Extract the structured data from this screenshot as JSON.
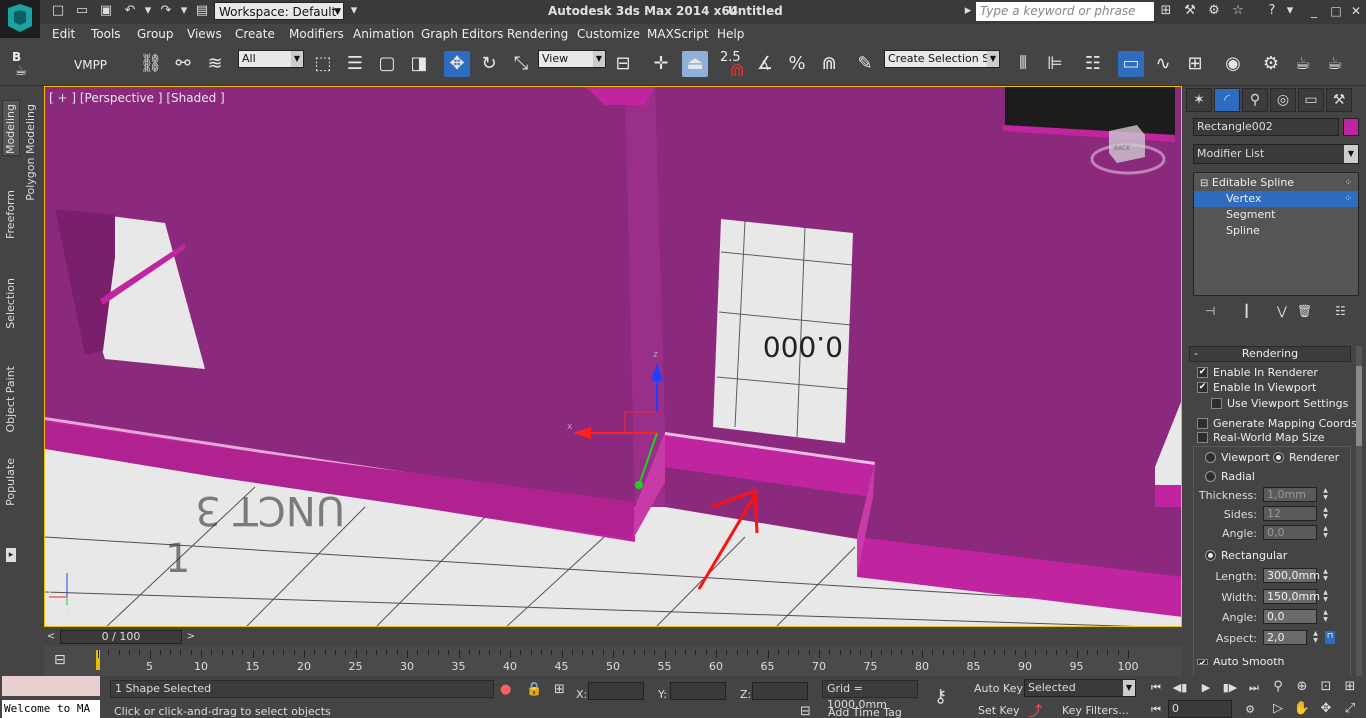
{
  "title_bar": {
    "app_title": "Autodesk 3ds Max  2014 x64",
    "doc_title": "Untitled",
    "workspace": "Workspace: Default",
    "search_placeholder": "Type a keyword or phrase"
  },
  "menu": [
    "Edit",
    "Tools",
    "Group",
    "Views",
    "Create",
    "Modifiers",
    "Animation",
    "Graph Editors",
    "Rendering",
    "Customize",
    "MAXScript",
    "Help"
  ],
  "toolbar": {
    "vmpp_label": "VMPP",
    "b_label": "B",
    "selection_filter": "All",
    "ref_coord": "View",
    "snap_angle": "2.5",
    "named_selection": "Create Selection Se"
  },
  "ribbon_tabs": [
    "Modeling",
    "Polygon Modeling",
    "Freeform",
    "Selection",
    "Object Paint",
    "Populate"
  ],
  "viewport": {
    "label": "[ + ] [Perspective ] [Shaded ]",
    "axis_x": "x",
    "axis_y": "y",
    "axis_z": "z",
    "viewcube_label": "BACK",
    "floor_text_a": "0.000",
    "floor_text_b": "UNCT 3",
    "floor_text_c": "1"
  },
  "command_panel": {
    "object_name": "Rectangle002",
    "object_color": "#c0249f",
    "modifier_list": "Modifier List",
    "stack": [
      {
        "label": "Editable Spline",
        "level": 0,
        "selected": false
      },
      {
        "label": "Vertex",
        "level": 1,
        "selected": true
      },
      {
        "label": "Segment",
        "level": 1,
        "selected": false
      },
      {
        "label": "Spline",
        "level": 1,
        "selected": false
      }
    ],
    "rollout_title": "Rendering",
    "enable_in_renderer": "Enable In Renderer",
    "enable_in_viewport": "Enable In Viewport",
    "use_viewport_settings": "Use Viewport Settings",
    "generate_mapping": "Generate Mapping Coords.",
    "real_world_map": "Real-World Map Size",
    "viewport_radio": "Viewport",
    "renderer_radio": "Renderer",
    "radial": "Radial",
    "thickness_label": "Thickness:",
    "thickness_value": "1,0mm",
    "sides_label": "Sides:",
    "sides_value": "12",
    "angle_label": "Angle:",
    "angle_value_radial": "0,0",
    "rectangular": "Rectangular",
    "length_label": "Length:",
    "length_value": "300,0mm",
    "width_label": "Width:",
    "width_value": "150,0mm",
    "angle_value_rect": "0,0",
    "aspect_label": "Aspect:",
    "aspect_value": "2,0",
    "auto_smooth": "Auto Smooth"
  },
  "timeline": {
    "frame": "0 / 100",
    "ticks": [
      "5",
      "10",
      "15",
      "20",
      "25",
      "30",
      "35",
      "40",
      "45",
      "50",
      "55",
      "60",
      "65",
      "70",
      "75",
      "80",
      "85",
      "90",
      "95",
      "100"
    ]
  },
  "status": {
    "maxscript_text": "Welcome to MA",
    "selected_count": "1 Shape Selected",
    "prompt": "Click or click-and-drag to select objects",
    "x_label": "X:",
    "y_label": "Y:",
    "z_label": "Z:",
    "grid": "Grid = 1000,0mm",
    "add_time_tag": "Add Time Tag",
    "auto_key": "Auto Key",
    "set_key": "Set Key",
    "key_mode": "Selected",
    "key_filters": "Key Filters...",
    "frame_value": "0"
  }
}
